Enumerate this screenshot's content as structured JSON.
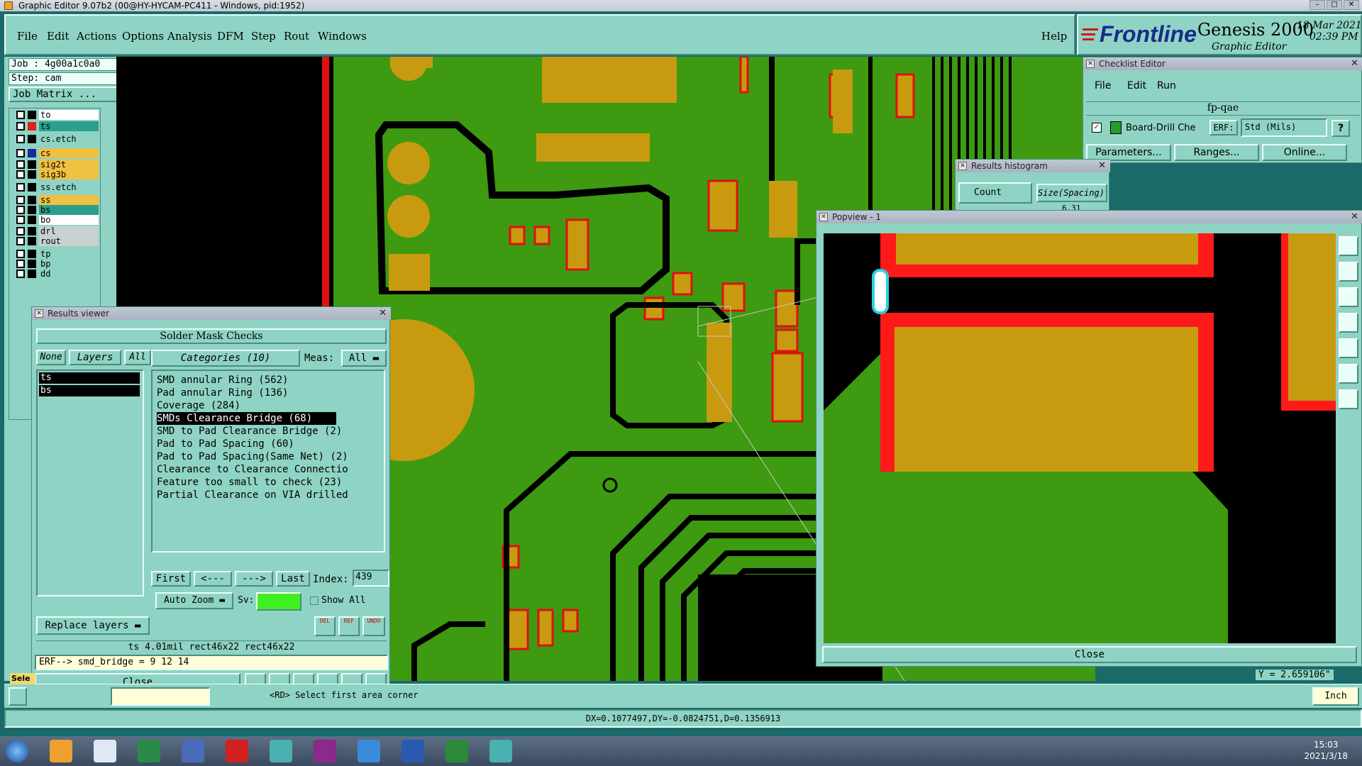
{
  "window": {
    "title": "Graphic Editor 9.07b2 (00@HY-HYCAM-PC411 - Windows, pid:1952)"
  },
  "menubar": {
    "items": [
      "File",
      "Edit",
      "Actions",
      "Options",
      "Analysis",
      "DFM",
      "Step",
      "Rout",
      "Windows"
    ],
    "help": "Help"
  },
  "brand": {
    "logo_text": "Frontline",
    "product": "Genesis 2000",
    "subtitle": "Graphic Editor",
    "date": "18 Mar 2021",
    "time": "02:39 PM"
  },
  "left_panel": {
    "job": "Job : 4g00a1c0a0",
    "step": "Step: cam",
    "job_matrix": "Job Matrix ...",
    "layers": [
      {
        "name": "to",
        "color": "#ffffff",
        "active": false,
        "swatch": "#000000"
      },
      {
        "name": "ts",
        "color": "#2aa08a",
        "active": false,
        "swatch": "#e02020"
      },
      {
        "name": "cs.etch",
        "color": "#8fd3c4",
        "active": false,
        "swatch": "#000000"
      },
      {
        "name": "cs",
        "color": "#f0c040",
        "active": true,
        "swatch": "#1a2a9a"
      },
      {
        "name": "sig2t",
        "color": "#f0c040",
        "active": false,
        "swatch": "#000000"
      },
      {
        "name": "sig3b",
        "color": "#f0c040",
        "active": false,
        "swatch": "#000000"
      },
      {
        "name": "ss.etch",
        "color": "#8fd3c4",
        "active": false,
        "swatch": "#000000"
      },
      {
        "name": "ss",
        "color": "#f0c040",
        "active": false,
        "swatch": "#000000"
      },
      {
        "name": "bs",
        "color": "#2aa08a",
        "active": false,
        "swatch": "#000000"
      },
      {
        "name": "bo",
        "color": "#ffffff",
        "active": false,
        "swatch": "#000000"
      },
      {
        "name": "drl",
        "color": "#c8d0d0",
        "active": false,
        "swatch": "#000000"
      },
      {
        "name": "rout",
        "color": "#c8d0d0",
        "active": false,
        "swatch": "#000000"
      },
      {
        "name": "tp",
        "color": "#8fd3c4",
        "active": false,
        "swatch": "#000000"
      },
      {
        "name": "bp",
        "color": "#8fd3c4",
        "active": false,
        "swatch": "#000000"
      },
      {
        "name": "dd",
        "color": "#8fd3c4",
        "active": false,
        "swatch": "#000000"
      }
    ]
  },
  "checklist_editor": {
    "title": "Checklist Editor",
    "menu": [
      "File",
      "Edit",
      "Run"
    ],
    "name": "fp-qae",
    "check_label": "Board-Drill Che",
    "erf_label": "ERF:",
    "erf_value": "Std (Mils)",
    "help": "?",
    "buttons": [
      "Parameters...",
      "Ranges...",
      "Online..."
    ]
  },
  "results_histogram": {
    "title": "Results histogram",
    "count_label": "Count",
    "column_label": "Size(Spacing) / Min(Spacing)",
    "value": "6.31"
  },
  "popview": {
    "title": "Popview - 1",
    "close": "Close",
    "coord": "Y = 2.659106\""
  },
  "results_viewer": {
    "title": "Results viewer",
    "header": "Solder Mask Checks",
    "none_btn": "None",
    "layers_btn": "Layers",
    "all_btn": "All",
    "categories_btn": "Categories (10)",
    "meas_label": "Meas:",
    "meas_value": "All",
    "layers": [
      "ts",
      "bs"
    ],
    "categories": [
      "SMD annular Ring (562)",
      "Pad annular Ring (136)",
      "Coverage (284)",
      "SMDs Clearance Bridge (68)",
      "SMD to Pad Clearance Bridge (2)",
      "Pad to Pad Spacing (60)",
      "Pad to Pad Spacing(Same Net) (2)",
      "Clearance to Clearance Connectio",
      "Feature too small to check (23)",
      "Partial Clearance on VIA drilled"
    ],
    "selected_index": 3,
    "nav": {
      "first": "First",
      "prev": "<---",
      "next": "--->",
      "last": "Last",
      "index_label": "Index:",
      "index_value": "439"
    },
    "auto_zoom": "Auto Zoom",
    "sv_label": "Sv:",
    "show_all": "Show All",
    "replace_layers": "Replace layers",
    "icon_btns": [
      "DEL",
      "REF",
      "UNDO"
    ],
    "info": "ts 4.01mil  rect46x22  rect46x22",
    "erf": "ERF--> smd_bridge = 9 12 14",
    "close": "Close"
  },
  "bottom": {
    "sele": "Sele",
    "prompt": "<RD> Select first area corner",
    "unit": "Inch",
    "measure": "DX=0.1077497,DY=-0.0824751,D=0.1356913"
  },
  "taskbar": {
    "time": "15:03",
    "date": "2021/3/18"
  },
  "colors": {
    "panel": "#8fd3c4",
    "board_green": "#3e9a10",
    "pad_gold": "#c89a10",
    "clearance_red": "#ff1a1a"
  }
}
